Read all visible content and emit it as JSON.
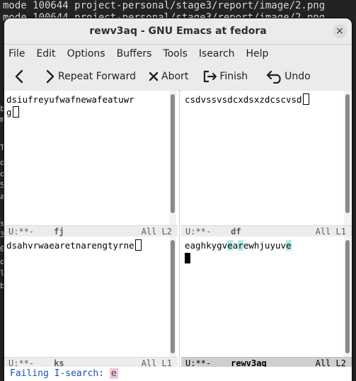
{
  "terminal": {
    "line1": "mode 100644 project-personal/stage3/report/image/2.png",
    "line2": "mode 100644 project-personal/stage3/report/image/2.png",
    "left_fragments": [
      "b",
      "m",
      "",
      "T",
      "o",
      "o",
      "5",
      "a",
      "",
      "s",
      "3",
      "0",
      "o",
      "l",
      "b"
    ]
  },
  "window": {
    "title": "rewv3aq - GNU Emacs at fedora",
    "close_glyph": "×"
  },
  "menu": [
    "File",
    "Edit",
    "Options",
    "Buffers",
    "Tools",
    "Isearch",
    "Help"
  ],
  "toolbar": {
    "repeat_forward": "Repeat Forward",
    "abort": "Abort",
    "finish": "Finish",
    "undo": "Undo"
  },
  "panes": {
    "top_left": {
      "line1": "dsiufreyufwafnewafeatuwr",
      "line2": "g",
      "modeline_status": "U:**-",
      "buffer_name": "fj",
      "position": "All L2"
    },
    "top_right": {
      "line1": "csdvssvsdcxdsxzdcscvsd",
      "modeline_status": "U:**-",
      "buffer_name": "df",
      "position": "All L1"
    },
    "bottom_left": {
      "line1": "dsahvrwaearetnarengtyrne",
      "modeline_status": "U:**-",
      "buffer_name": "ks",
      "position": "All L1"
    },
    "bottom_right": {
      "segments": [
        "",
        "e",
        "aghkygv",
        "e",
        "a",
        "r",
        "",
        "e",
        "whjuyuv",
        "e",
        ""
      ],
      "modeline_status": "U:**-",
      "buffer_name": "rewv3aq",
      "position": "All L2"
    }
  },
  "minibuffer": {
    "prompt": "Failing I-search: ",
    "input": "e"
  }
}
